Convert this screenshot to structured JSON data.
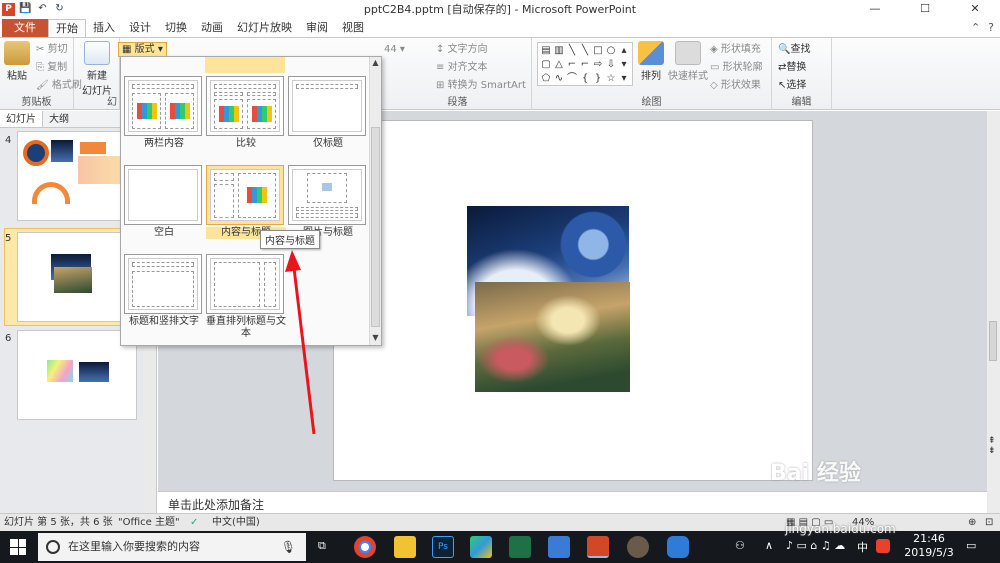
{
  "window": {
    "title": "pptC2B4.pptm [自动保存的] - Microsoft PowerPoint",
    "app_logo": "P",
    "minimize": "—",
    "maximize": "☐",
    "close": "✕"
  },
  "tabs": [
    "文件",
    "开始",
    "插入",
    "设计",
    "切换",
    "动画",
    "幻灯片放映",
    "审阅",
    "视图"
  ],
  "ribbon": {
    "paste": "粘贴",
    "cut": "剪切",
    "copy": "复制",
    "format_painter": "格式刷",
    "clipboard_group": "剪贴板",
    "new_slide": "新建",
    "new_slide2": "幻灯片",
    "layout": "版式",
    "font_size": "44",
    "text_direction": "文字方向",
    "align_text": "对齐文本",
    "smartart": "转换为 SmartArt",
    "paragraph_group": "段落",
    "arrange": "排列",
    "quick_styles": "快速样式",
    "shape_fill": "形状填充",
    "shape_outline": "形状轮廓",
    "shape_effects": "形状效果",
    "drawing_group": "绘图",
    "find": "查找",
    "replace": "替换",
    "select": "选择",
    "editing_group": "编辑",
    "group_slides_partial": "幻"
  },
  "panel": {
    "tab_slides": "幻灯片",
    "tab_outline": "大纲",
    "slide_numbers": [
      "4",
      "5",
      "6"
    ]
  },
  "layouts": {
    "items": [
      {
        "label": "两栏内容"
      },
      {
        "label": "比较"
      },
      {
        "label": "仅标题"
      },
      {
        "label": "空白"
      },
      {
        "label": "内容与标题"
      },
      {
        "label": "图片与标题"
      },
      {
        "label": "标题和竖排文字"
      },
      {
        "label": "垂直排列标题与文本"
      }
    ],
    "tooltip": "内容与标题"
  },
  "notes_placeholder": "单击此处添加备注",
  "status": {
    "slide_info": "幻灯片 第 5 张，共 6 张",
    "theme": "\"Office 主题\"",
    "language": "中文(中国)",
    "zoom": "44%"
  },
  "taskbar": {
    "search_placeholder": "在这里输入你要搜索的内容",
    "time": "21:46",
    "date": "2019/5/3",
    "ime": "中"
  },
  "watermark": {
    "brand": "Bai 经验",
    "url": "jingyan.baidu.com"
  },
  "colors": {
    "file_tab": "#c75332",
    "highlight": "#fde49a",
    "arrow": "#e8161c",
    "taskbar": "#15191e"
  }
}
